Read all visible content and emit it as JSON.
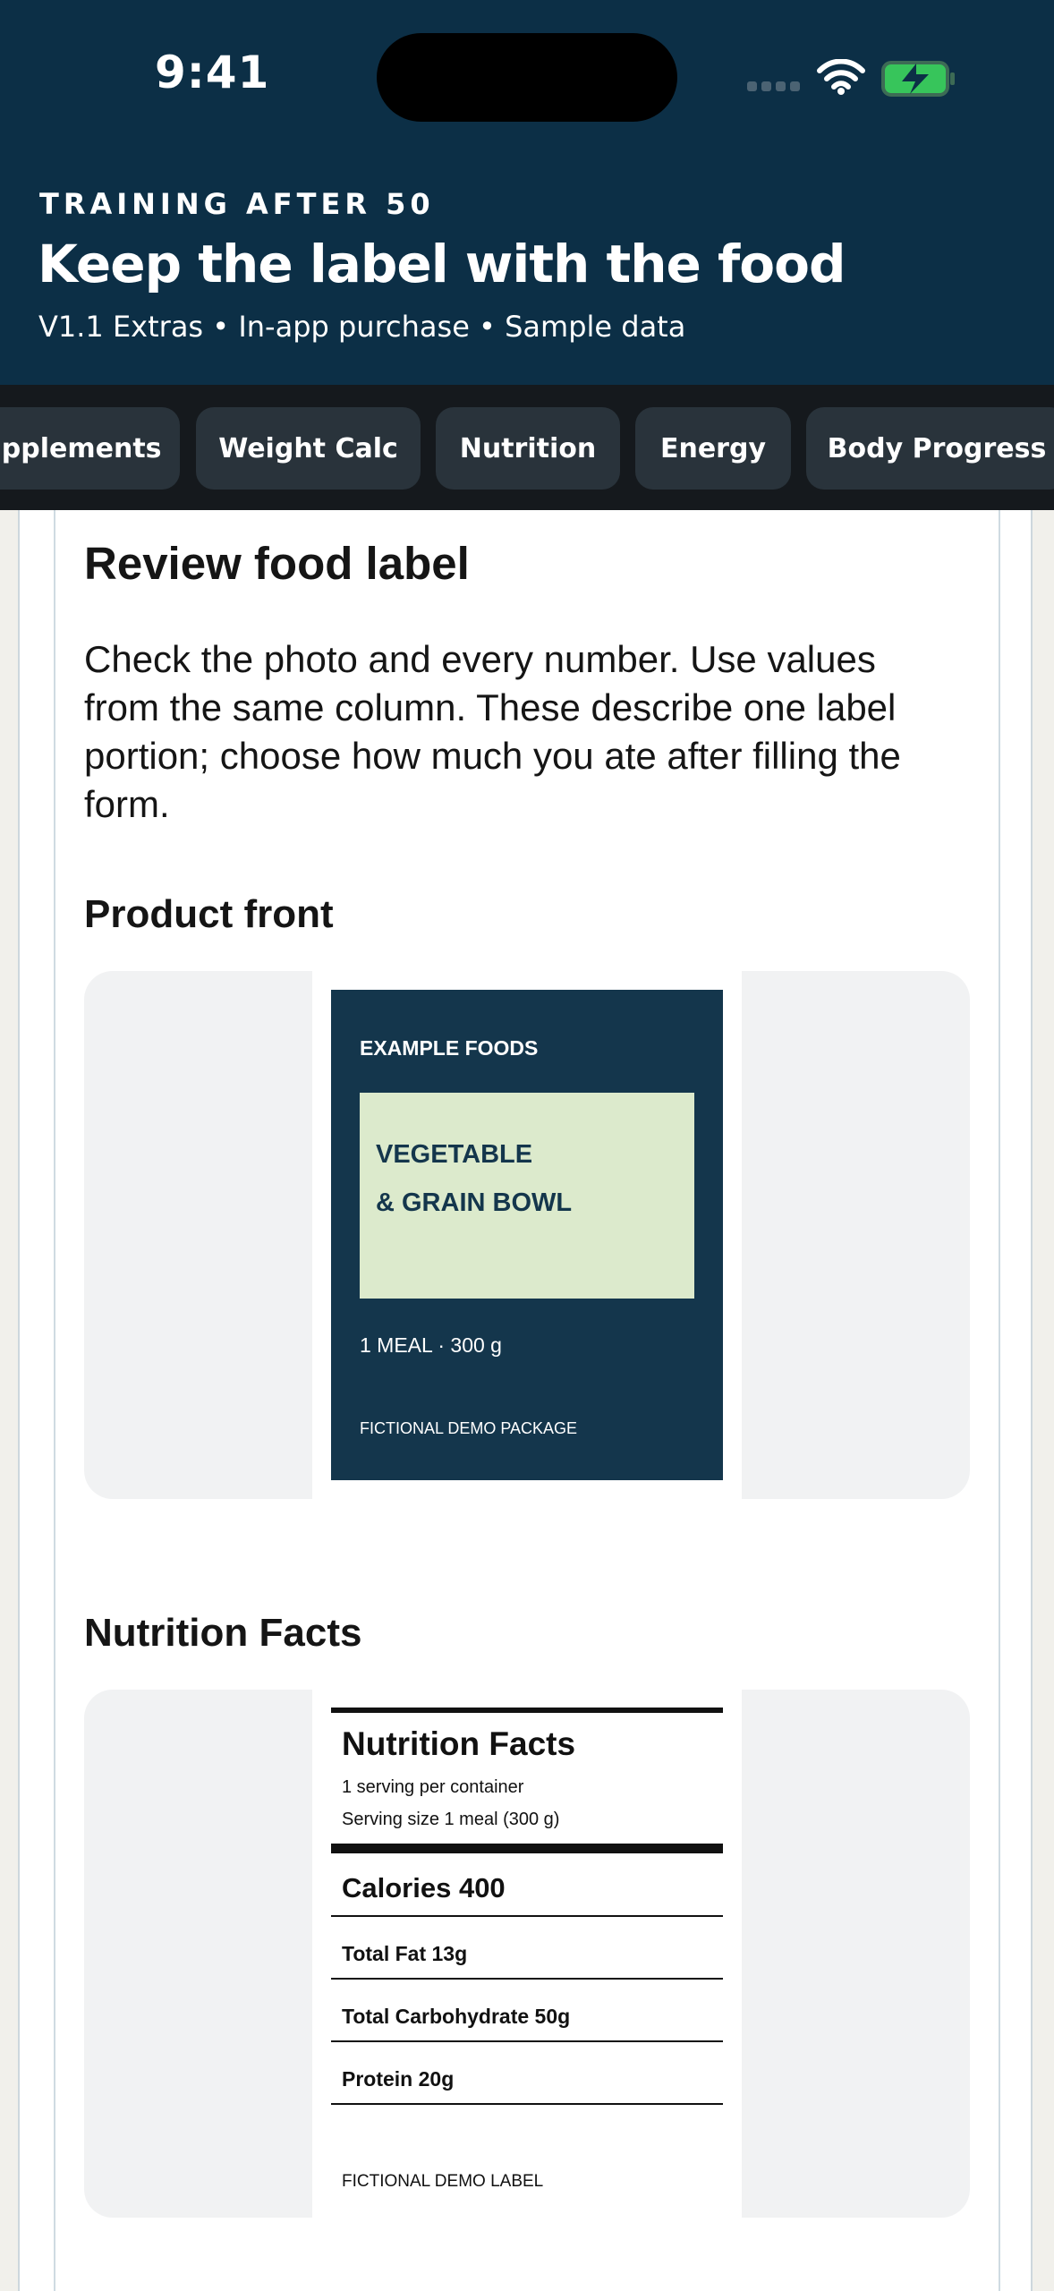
{
  "status_bar": {
    "time": "9:41"
  },
  "header": {
    "kicker": "TRAINING AFTER 50",
    "title": "Keep the label with the food",
    "subtitle": "V1.1 Extras • In-app purchase • Sample data"
  },
  "tabs": [
    {
      "label": "upplements"
    },
    {
      "label": "Weight Calc"
    },
    {
      "label": "Nutrition"
    },
    {
      "label": "Energy"
    },
    {
      "label": "Body Progress"
    }
  ],
  "review": {
    "title": "Review food label",
    "instructions": "Check the photo and every number. Use values from the same column. These describe one label portion; choose how much you ate after filling the form."
  },
  "product_front": {
    "heading": "Product front",
    "brand": "EXAMPLE FOODS",
    "product_line_1": "VEGETABLE",
    "product_line_2": "& GRAIN BOWL",
    "size": "1 MEAL · 300 g",
    "footer": "FICTIONAL DEMO PACKAGE"
  },
  "nutrition_facts": {
    "heading": "Nutrition Facts",
    "label_title": "Nutrition Facts",
    "servings": "1 serving per container",
    "serving_size": "Serving size 1 meal (300 g)",
    "calories": "Calories 400",
    "total_fat": "Total Fat 13g",
    "total_carbohydrate": "Total Carbohydrate 50g",
    "protein": "Protein 20g",
    "footer": "FICTIONAL DEMO LABEL"
  },
  "colors": {
    "header": "#0c2f46",
    "tabs_background": "#15191d",
    "tab": "#29333b",
    "package": "#14364c",
    "package_accent": "#dceacc",
    "battery": "#37c55b"
  },
  "icons": [
    "cellular-signal-icon",
    "wifi-icon",
    "charging-battery-icon"
  ]
}
